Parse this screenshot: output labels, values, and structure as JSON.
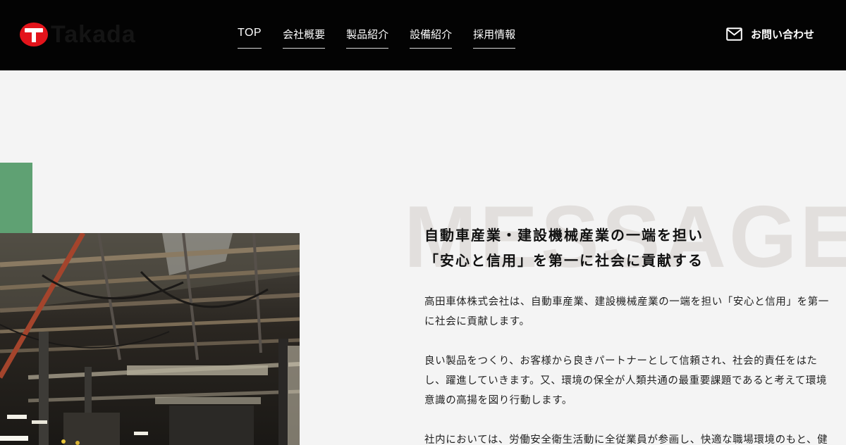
{
  "header": {
    "logo_text": "Takada",
    "nav": [
      "TOP",
      "会社概要",
      "製品紹介",
      "設備紹介",
      "採用情報"
    ],
    "contact_label": "お問い合わせ"
  },
  "message": {
    "watermark": "MESSAGE",
    "headline": [
      "自動車産業・建設機械産業の一端を担い",
      "「安心と信用」を第一に社会に貢献する"
    ],
    "paragraphs": [
      [
        "高田車体株式会社は、自動車産業、建設機械産業の一端を担い「安心と信用」を第一",
        "に社会に貢献します。"
      ],
      [
        "良い製品をつくり、お客様から良きパートナーとして信頼され、社会的責任をはた",
        "し、躍進していきます。又、環境の保全が人類共通の最重要課題であると考えて環境",
        "意識の高揚を図り行動します。"
      ],
      [
        "社内においては、労働安全衛生活動に全従業員が参画し、快適な職場環境のもと、健"
      ]
    ]
  },
  "colors": {
    "header_bg": "#030303",
    "logo_red": "#e3141b",
    "accent_green": "#5fa173",
    "page_bg": "#f4f4f4",
    "watermark": "#e2dfdd"
  },
  "icons": {
    "logo": "takada-t-logo-icon",
    "contact": "envelope-icon"
  }
}
